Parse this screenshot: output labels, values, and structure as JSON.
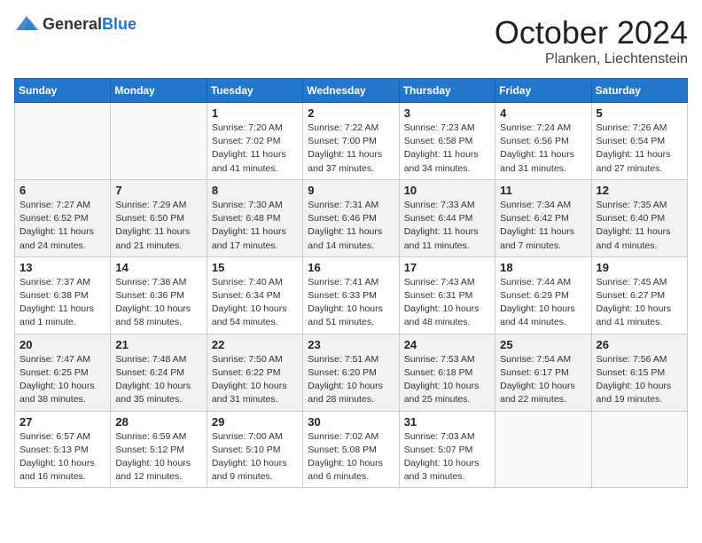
{
  "header": {
    "logo_general": "General",
    "logo_blue": "Blue",
    "month_title": "October 2024",
    "location": "Planken, Liechtenstein"
  },
  "weekdays": [
    "Sunday",
    "Monday",
    "Tuesday",
    "Wednesday",
    "Thursday",
    "Friday",
    "Saturday"
  ],
  "weeks": [
    {
      "shaded": false,
      "days": [
        {
          "num": "",
          "info": ""
        },
        {
          "num": "",
          "info": ""
        },
        {
          "num": "1",
          "info": "Sunrise: 7:20 AM\nSunset: 7:02 PM\nDaylight: 11 hours and 41 minutes."
        },
        {
          "num": "2",
          "info": "Sunrise: 7:22 AM\nSunset: 7:00 PM\nDaylight: 11 hours and 37 minutes."
        },
        {
          "num": "3",
          "info": "Sunrise: 7:23 AM\nSunset: 6:58 PM\nDaylight: 11 hours and 34 minutes."
        },
        {
          "num": "4",
          "info": "Sunrise: 7:24 AM\nSunset: 6:56 PM\nDaylight: 11 hours and 31 minutes."
        },
        {
          "num": "5",
          "info": "Sunrise: 7:26 AM\nSunset: 6:54 PM\nDaylight: 11 hours and 27 minutes."
        }
      ]
    },
    {
      "shaded": true,
      "days": [
        {
          "num": "6",
          "info": "Sunrise: 7:27 AM\nSunset: 6:52 PM\nDaylight: 11 hours and 24 minutes."
        },
        {
          "num": "7",
          "info": "Sunrise: 7:29 AM\nSunset: 6:50 PM\nDaylight: 11 hours and 21 minutes."
        },
        {
          "num": "8",
          "info": "Sunrise: 7:30 AM\nSunset: 6:48 PM\nDaylight: 11 hours and 17 minutes."
        },
        {
          "num": "9",
          "info": "Sunrise: 7:31 AM\nSunset: 6:46 PM\nDaylight: 11 hours and 14 minutes."
        },
        {
          "num": "10",
          "info": "Sunrise: 7:33 AM\nSunset: 6:44 PM\nDaylight: 11 hours and 11 minutes."
        },
        {
          "num": "11",
          "info": "Sunrise: 7:34 AM\nSunset: 6:42 PM\nDaylight: 11 hours and 7 minutes."
        },
        {
          "num": "12",
          "info": "Sunrise: 7:35 AM\nSunset: 6:40 PM\nDaylight: 11 hours and 4 minutes."
        }
      ]
    },
    {
      "shaded": false,
      "days": [
        {
          "num": "13",
          "info": "Sunrise: 7:37 AM\nSunset: 6:38 PM\nDaylight: 11 hours and 1 minute."
        },
        {
          "num": "14",
          "info": "Sunrise: 7:38 AM\nSunset: 6:36 PM\nDaylight: 10 hours and 58 minutes."
        },
        {
          "num": "15",
          "info": "Sunrise: 7:40 AM\nSunset: 6:34 PM\nDaylight: 10 hours and 54 minutes."
        },
        {
          "num": "16",
          "info": "Sunrise: 7:41 AM\nSunset: 6:33 PM\nDaylight: 10 hours and 51 minutes."
        },
        {
          "num": "17",
          "info": "Sunrise: 7:43 AM\nSunset: 6:31 PM\nDaylight: 10 hours and 48 minutes."
        },
        {
          "num": "18",
          "info": "Sunrise: 7:44 AM\nSunset: 6:29 PM\nDaylight: 10 hours and 44 minutes."
        },
        {
          "num": "19",
          "info": "Sunrise: 7:45 AM\nSunset: 6:27 PM\nDaylight: 10 hours and 41 minutes."
        }
      ]
    },
    {
      "shaded": true,
      "days": [
        {
          "num": "20",
          "info": "Sunrise: 7:47 AM\nSunset: 6:25 PM\nDaylight: 10 hours and 38 minutes."
        },
        {
          "num": "21",
          "info": "Sunrise: 7:48 AM\nSunset: 6:24 PM\nDaylight: 10 hours and 35 minutes."
        },
        {
          "num": "22",
          "info": "Sunrise: 7:50 AM\nSunset: 6:22 PM\nDaylight: 10 hours and 31 minutes."
        },
        {
          "num": "23",
          "info": "Sunrise: 7:51 AM\nSunset: 6:20 PM\nDaylight: 10 hours and 28 minutes."
        },
        {
          "num": "24",
          "info": "Sunrise: 7:53 AM\nSunset: 6:18 PM\nDaylight: 10 hours and 25 minutes."
        },
        {
          "num": "25",
          "info": "Sunrise: 7:54 AM\nSunset: 6:17 PM\nDaylight: 10 hours and 22 minutes."
        },
        {
          "num": "26",
          "info": "Sunrise: 7:56 AM\nSunset: 6:15 PM\nDaylight: 10 hours and 19 minutes."
        }
      ]
    },
    {
      "shaded": false,
      "days": [
        {
          "num": "27",
          "info": "Sunrise: 6:57 AM\nSunset: 5:13 PM\nDaylight: 10 hours and 16 minutes."
        },
        {
          "num": "28",
          "info": "Sunrise: 6:59 AM\nSunset: 5:12 PM\nDaylight: 10 hours and 12 minutes."
        },
        {
          "num": "29",
          "info": "Sunrise: 7:00 AM\nSunset: 5:10 PM\nDaylight: 10 hours and 9 minutes."
        },
        {
          "num": "30",
          "info": "Sunrise: 7:02 AM\nSunset: 5:08 PM\nDaylight: 10 hours and 6 minutes."
        },
        {
          "num": "31",
          "info": "Sunrise: 7:03 AM\nSunset: 5:07 PM\nDaylight: 10 hours and 3 minutes."
        },
        {
          "num": "",
          "info": ""
        },
        {
          "num": "",
          "info": ""
        }
      ]
    }
  ]
}
